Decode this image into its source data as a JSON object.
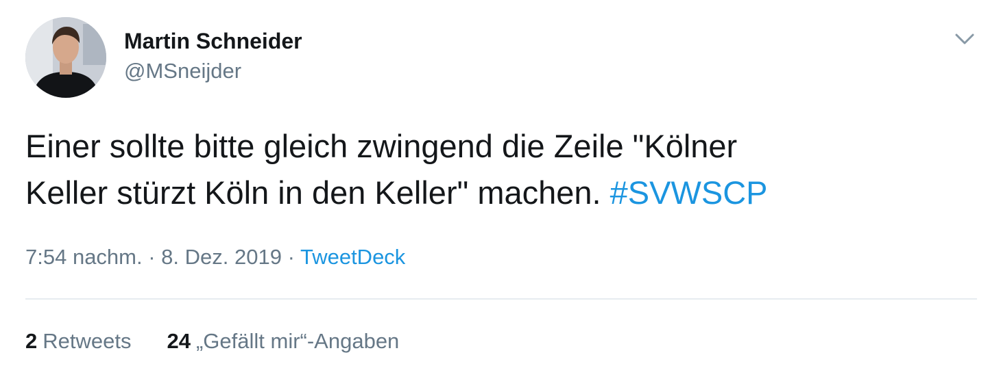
{
  "author": {
    "display_name": "Martin Schneider",
    "handle": "@MSneijder"
  },
  "tweet": {
    "text_line1": "Einer sollte bitte gleich zwingend die Zeile \"Kölner",
    "text_line2": "Keller stürzt Köln in den Keller\" machen.",
    "hashtag": "#SVWSCP"
  },
  "meta": {
    "time": "7:54 nachm.",
    "separator1": " · ",
    "date": "8. Dez. 2019",
    "separator2": " · ",
    "source": "TweetDeck"
  },
  "stats": {
    "retweets_count": "2",
    "retweets_label": "Retweets",
    "likes_count": "24",
    "likes_label": "„Gefällt mir“-Angaben"
  },
  "colors": {
    "link": "#1b95e0",
    "secondary_text": "#657786",
    "primary_text": "#14171a",
    "divider": "#e6ecf0"
  },
  "icons": {
    "menu": "chevron-down-icon",
    "avatar": "profile-photo"
  }
}
